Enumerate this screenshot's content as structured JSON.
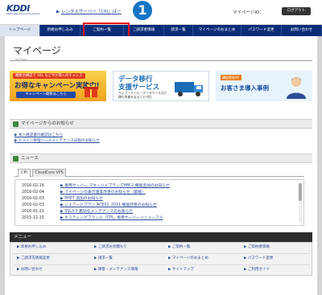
{
  "header": {
    "logo_text": "KDDI",
    "logo_sub": "KDDI Web Communications",
    "breadcrumb_link": "レンタルサーバー「CPI」ほー",
    "my_id_label": "マイページID：",
    "logout_label": "ログアウト"
  },
  "callout": {
    "number": "1"
  },
  "nav": {
    "items": [
      {
        "label": "トップページ",
        "active": true
      },
      {
        "label": "新規お申し込み",
        "active": false
      },
      {
        "label": "ご契約一覧",
        "active": false
      },
      {
        "label": "ご請求者情報",
        "active": false
      },
      {
        "label": "請求一覧",
        "active": false
      },
      {
        "label": "マイページのおまとめ",
        "active": false
      },
      {
        "label": "パスワード変更",
        "active": false
      },
      {
        "label": "お問い合わせ",
        "active": false
      }
    ]
  },
  "page": {
    "title": "マイページ",
    "title_en": "My Page"
  },
  "banners": {
    "b1_tag": "複数台構成で SSL など今が導入のチャンス",
    "b1_main": "お得なキャンペーン実施中!",
    "b1_button": "キャンペーン概要はこちら",
    "b2_line1": "データ移行",
    "b2_line2": "支援サービス",
    "b2_sub1": "ウェブ・メール・データベースなど",
    "b2_sub2": "移行作業をまるごと代行",
    "b3_tag": "積極実装中!",
    "b3_main": "お客さま導入事例"
  },
  "notices": {
    "title": "マイページからのお知らせ",
    "items": [
      "▶ 本人確認書の確認はこちら",
      "▶ ドメイン管理ツールメンテナンス日程のお知らせ"
    ]
  },
  "news": {
    "title": "ニュース",
    "tabs": [
      "CPI",
      "CloudCore VPS"
    ],
    "rows": [
      {
        "date": "2016-02-16",
        "title": "専用サーバー マネージドプラン CHM-2 機能追加のお知らせ"
      },
      {
        "date": "2016-02-04",
        "title": "マイページの表示速度改善のお知らせ（第報）"
      },
      {
        "date": "2016-02-03",
        "title": "PHP7 追加のお知らせ"
      },
      {
        "date": "2016-02-03",
        "title": "シェアードプラン ACE01_2011 機能改善のお知らせ"
      },
      {
        "date": "2016-01-21",
        "title": "SSL3.0 無効化メンテナンスのお知らせ"
      },
      {
        "date": "2015-12-15",
        "title": "ホスティングブランド「CPI」専用サーバーリニューアル"
      }
    ]
  },
  "menu": {
    "title": "メニュー",
    "rows": [
      [
        "新規お申し込み",
        "ご請求お見積もり",
        "ご契約一覧",
        "ご契約者情報"
      ],
      [
        "ご請求先情報変更",
        "請求一覧",
        "マイページのおまとめ",
        "パスワード変更"
      ],
      [
        "お問い合わせ",
        "障害・メンテナンス情報",
        "サイトマップ",
        "ご利用ガイド"
      ]
    ]
  },
  "colors": {
    "nav_bg": "#0b2d78",
    "callout": "#1674c6",
    "highlight": "#e8161a",
    "link": "#2a4b9b"
  }
}
